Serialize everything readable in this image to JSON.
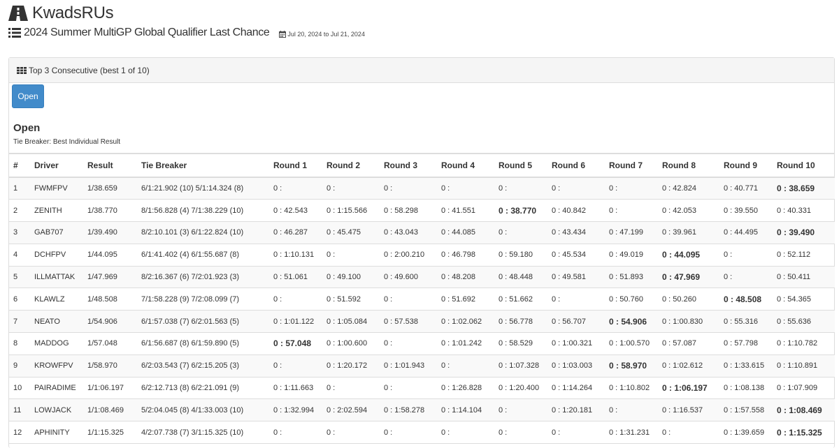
{
  "site": {
    "title": "KwadsRUs"
  },
  "event": {
    "title": "2024 Summer MultiGP Global Qualifier Last Chance",
    "dates": "Jul 20, 2024 to Jul 21, 2024"
  },
  "panel": {
    "heading": "Top 3 Consecutive (best 1 of 10)",
    "class_button": "Open",
    "class_title": "Open",
    "tie_breaker_note": "Tie Breaker: Best Individual Result"
  },
  "table": {
    "headers": [
      "#",
      "Driver",
      "Result",
      "Tie Breaker",
      "Round 1",
      "Round 2",
      "Round 3",
      "Round 4",
      "Round 5",
      "Round 6",
      "Round 7",
      "Round 8",
      "Round 9",
      "Round 10"
    ],
    "rows": [
      {
        "pos": "1",
        "driver": "FWMFPV",
        "result": "1/38.659",
        "tie": "6/1:21.902 (10) 5/1:14.324 (8)",
        "best_round": 10,
        "rounds": [
          "0 :",
          "0 :",
          "0 :",
          "0 :",
          "0 :",
          "0 :",
          "0 :",
          "0 : 42.824",
          "0 : 40.771",
          "0 : 38.659"
        ]
      },
      {
        "pos": "2",
        "driver": "ZENITH",
        "result": "1/38.770",
        "tie": "8/1:56.828 (4) 7/1:38.229 (10)",
        "best_round": 5,
        "rounds": [
          "0 : 42.543",
          "0 : 1:15.566",
          "0 : 58.298",
          "0 : 41.551",
          "0 : 38.770",
          "0 : 40.842",
          "0 :",
          "0 : 42.053",
          "0 : 39.550",
          "0 : 40.331"
        ]
      },
      {
        "pos": "3",
        "driver": "GAB707",
        "result": "1/39.490",
        "tie": "8/2:10.101 (3) 6/1:22.824 (10)",
        "best_round": 10,
        "rounds": [
          "0 : 46.287",
          "0 : 45.475",
          "0 : 43.043",
          "0 : 44.085",
          "0 :",
          "0 : 43.434",
          "0 : 47.199",
          "0 : 39.961",
          "0 : 44.495",
          "0 : 39.490"
        ]
      },
      {
        "pos": "4",
        "driver": "DCHFPV",
        "result": "1/44.095",
        "tie": "6/1:41.402 (4) 6/1:55.687 (8)",
        "best_round": 8,
        "rounds": [
          "0 : 1:10.131",
          "0 :",
          "0 : 2:00.210",
          "0 : 46.798",
          "0 : 59.180",
          "0 : 45.534",
          "0 : 49.019",
          "0 : 44.095",
          "0 :",
          "0 : 52.112"
        ]
      },
      {
        "pos": "5",
        "driver": "ILLMATTAK",
        "result": "1/47.969",
        "tie": "8/2:16.367 (6) 7/2:01.923 (3)",
        "best_round": 8,
        "rounds": [
          "0 : 51.061",
          "0 : 49.100",
          "0 : 49.600",
          "0 : 48.208",
          "0 : 48.448",
          "0 : 49.581",
          "0 : 51.893",
          "0 : 47.969",
          "0 :",
          "0 : 50.411"
        ]
      },
      {
        "pos": "6",
        "driver": "KLAWLZ",
        "result": "1/48.508",
        "tie": "7/1:58.228 (9) 7/2:08.099 (7)",
        "best_round": 9,
        "rounds": [
          "0 :",
          "0 : 51.592",
          "0 :",
          "0 : 51.692",
          "0 : 51.662",
          "0 :",
          "0 : 50.760",
          "0 : 50.260",
          "0 : 48.508",
          "0 : 54.365"
        ]
      },
      {
        "pos": "7",
        "driver": "NEATO",
        "result": "1/54.906",
        "tie": "6/1:57.038 (7) 6/2:01.563 (5)",
        "best_round": 7,
        "rounds": [
          "0 : 1:01.122",
          "0 : 1:05.084",
          "0 : 57.538",
          "0 : 1:02.062",
          "0 : 56.778",
          "0 : 56.707",
          "0 : 54.906",
          "0 : 1:00.830",
          "0 : 55.316",
          "0 : 55.636"
        ]
      },
      {
        "pos": "8",
        "driver": "MADDOG",
        "result": "1/57.048",
        "tie": "6/1:56.687 (8) 6/1:59.890 (5)",
        "best_round": 1,
        "rounds": [
          "0 : 57.048",
          "0 : 1:00.600",
          "0 :",
          "0 : 1:01.242",
          "0 : 58.529",
          "0 : 1:00.321",
          "0 : 1:00.570",
          "0 : 57.087",
          "0 : 57.798",
          "0 : 1:10.782"
        ]
      },
      {
        "pos": "9",
        "driver": "KROWFPV",
        "result": "1/58.970",
        "tie": "6/2:03.543 (7) 6/2:15.205 (3)",
        "best_round": 7,
        "rounds": [
          "0 :",
          "0 : 1:20.172",
          "0 : 1:01.943",
          "0 :",
          "0 : 1:07.328",
          "0 : 1:03.003",
          "0 : 58.970",
          "0 : 1:02.612",
          "0 : 1:33.615",
          "0 : 1:10.891"
        ]
      },
      {
        "pos": "10",
        "driver": "PAIRADIME",
        "result": "1/1:06.197",
        "tie": "6/2:12.713 (8) 6/2:21.091 (9)",
        "best_round": 8,
        "rounds": [
          "0 : 1:11.663",
          "0 :",
          "0 :",
          "0 : 1:26.828",
          "0 : 1:20.400",
          "0 : 1:14.264",
          "0 : 1:10.802",
          "0 : 1:06.197",
          "0 : 1:08.138",
          "0 : 1:07.909"
        ]
      },
      {
        "pos": "11",
        "driver": "LOWJACK",
        "result": "1/1:08.469",
        "tie": "5/2:04.045 (8) 4/1:33.003 (10)",
        "best_round": 10,
        "rounds": [
          "0 : 1:32.994",
          "0 : 2:02.594",
          "0 : 1:58.278",
          "0 : 1:14.104",
          "0 :",
          "0 : 1:20.181",
          "0 :",
          "0 : 1:16.537",
          "0 : 1:57.558",
          "0 : 1:08.469"
        ]
      },
      {
        "pos": "12",
        "driver": "APHINITY",
        "result": "1/1:15.325",
        "tie": "4/2:07.738 (7) 3/1:15.325 (10)",
        "best_round": 10,
        "rounds": [
          "0 :",
          "0 :",
          "0 :",
          "0 :",
          "0 :",
          "0 :",
          "0 : 1:31.231",
          "0 :",
          "0 : 1:39.659",
          "0 : 1:15.325"
        ]
      }
    ]
  },
  "colors": {
    "button": "#428bca",
    "border": "#dddddd",
    "stripe": "#f9f9f9",
    "text": "#333333"
  },
  "icons": {
    "logo": "road-logo-icon",
    "event": "list-icon",
    "date": "calendar-icon",
    "panel": "grid-icon"
  }
}
